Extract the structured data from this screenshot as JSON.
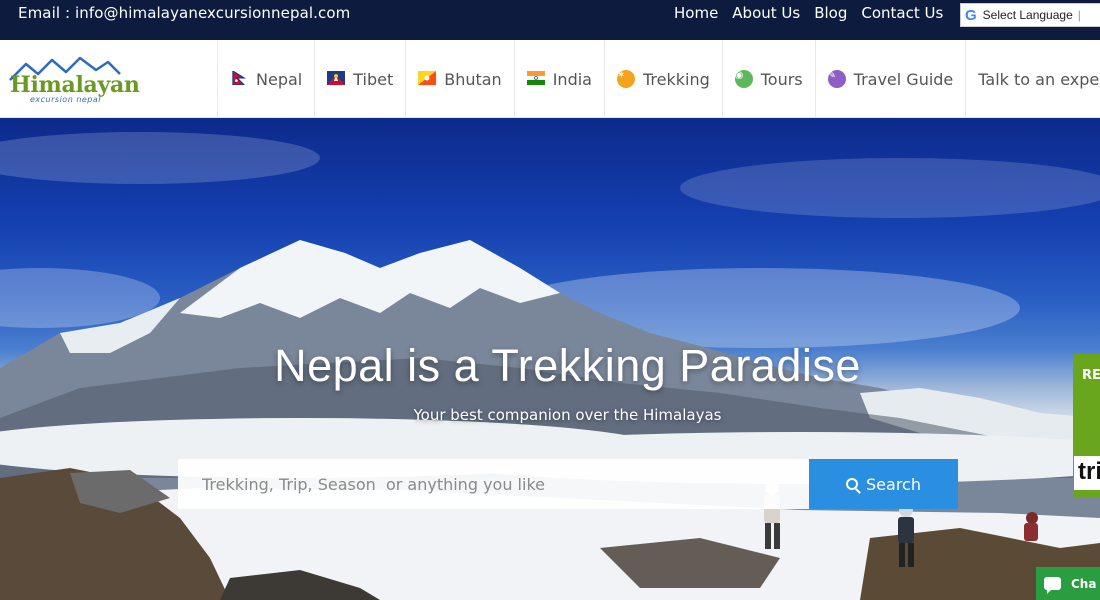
{
  "topbar": {
    "email": "Email : info@himalayanexcursionnepal.com",
    "links": [
      "Home",
      "About Us",
      "Blog",
      "Contact Us"
    ],
    "language_label": "Select Language",
    "language_icon": "google-g-icon"
  },
  "logo": {
    "brand": "Himalayan",
    "sub": "excursion nepal"
  },
  "nav": {
    "items": [
      {
        "label": "Nepal",
        "icon": "nepal-flag-icon"
      },
      {
        "label": "Tibet",
        "icon": "tibet-flag-icon"
      },
      {
        "label": "Bhutan",
        "icon": "bhutan-flag-icon"
      },
      {
        "label": "India",
        "icon": "india-flag-icon"
      },
      {
        "label": "Trekking",
        "icon": "trekking-icon"
      },
      {
        "label": "Tours",
        "icon": "tours-icon"
      },
      {
        "label": "Travel Guide",
        "icon": "travel-guide-icon"
      },
      {
        "label": "Talk to an expert",
        "icon": "chevron-down-icon"
      }
    ]
  },
  "hero": {
    "title": "Nepal is a Trekking Paradise",
    "tagline": "Your best companion over the Himalayas",
    "search_placeholder": "Trekking, Trip, Season  or anything you like",
    "search_button": "Search"
  },
  "side_tab": {
    "top_text": "RE",
    "bottom_text": "tri"
  },
  "chat": {
    "label": "Cha"
  },
  "colors": {
    "topbar_bg": "#0d1b3e",
    "search_button": "#2a8fe0",
    "side_tab": "#6aa51e",
    "chat": "#2a9d40",
    "logo_green": "#6a9a1f"
  }
}
